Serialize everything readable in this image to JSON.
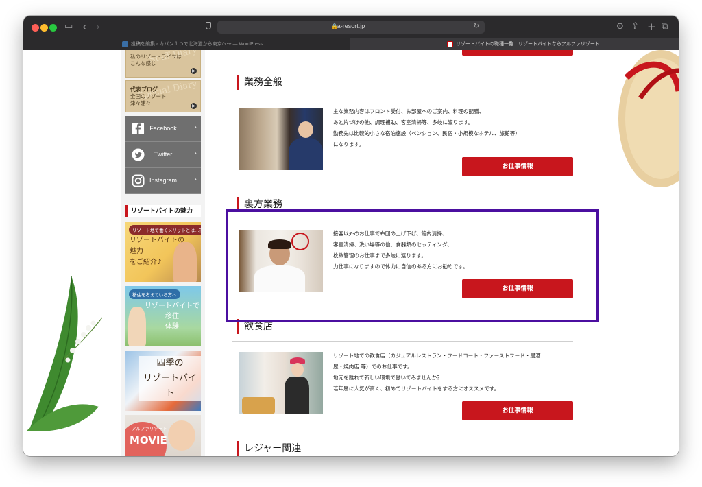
{
  "browser": {
    "url": "a-resort.jp",
    "tabs": [
      {
        "title": "投稿を編集 ‹ カバン１つで北海道から東京へ〜 — WordPress"
      },
      {
        "title": "リゾートバイトの職種一覧｜リゾートバイトならアルファリゾート"
      }
    ]
  },
  "sidebar": {
    "banners": [
      {
        "title": "",
        "text": "私のリゾートライフは\nこんな感じ",
        "script": "Staff Diary"
      },
      {
        "title": "代表ブログ",
        "text": "全国のリゾート\n津々浦々",
        "script": "Special Diary"
      }
    ],
    "social": [
      {
        "label": "Facebook",
        "icon": "facebook-icon"
      },
      {
        "label": "Twitter",
        "icon": "twitter-icon"
      },
      {
        "label": "Instagram",
        "icon": "instagram-icon"
      }
    ],
    "charm_heading": "リゾートバイトの魅力",
    "promos": [
      {
        "pill": "リゾート地で働くメリットとは…？",
        "big": "リゾートバイトの\n魅力\nをご紹介♪"
      },
      {
        "pill": "移住を考えている方へ",
        "big": "リゾートバイトで\n移住\n体験"
      },
      {
        "pill": "",
        "big": "四季の\nリゾートバイト"
      },
      {
        "pill": "アルファリゾート",
        "big": "MOVIE"
      }
    ]
  },
  "sections": [
    {
      "title": "業務全般",
      "description": "主な業務内容はフロント受付、お部屋へのご案内、料理の配膳、\nあと片づけの他、調理補助、客室清掃等、多岐に渡ります。\n勤務先は比較的小さな宿泊施設（ペンション、民宿・小規模なホテル、旅館等）\nになります。",
      "button": "お仕事情報"
    },
    {
      "title": "裏方業務",
      "description": "接客以外のお仕事で布団の上げ下げ、館内清掃、\n客室清掃、洗い場等の他、食器類のセッティング、\n枚数管理のお仕事まで多岐に渡ります。\n力仕事になりますので体力に自信のある方にお勧めです。",
      "button": "お仕事情報"
    },
    {
      "title": "飲食店",
      "description": "リゾート地での飲食店（カジュアルレストラン・フードコート・ファーストフード・居酒\n屋・焼肉店 等）でのお仕事です。\n地元を離れて新しい環境で働いてみませんか？\n若年層に人気が高く、初めてリゾートバイトをする方にオススメです。",
      "button": "お仕事情報"
    },
    {
      "title": "レジャー関連"
    }
  ],
  "colors": {
    "accent_red": "#c8161d",
    "highlight_purple": "#4b0fa0",
    "sidebar_social_bg": "#6f6f6f"
  }
}
